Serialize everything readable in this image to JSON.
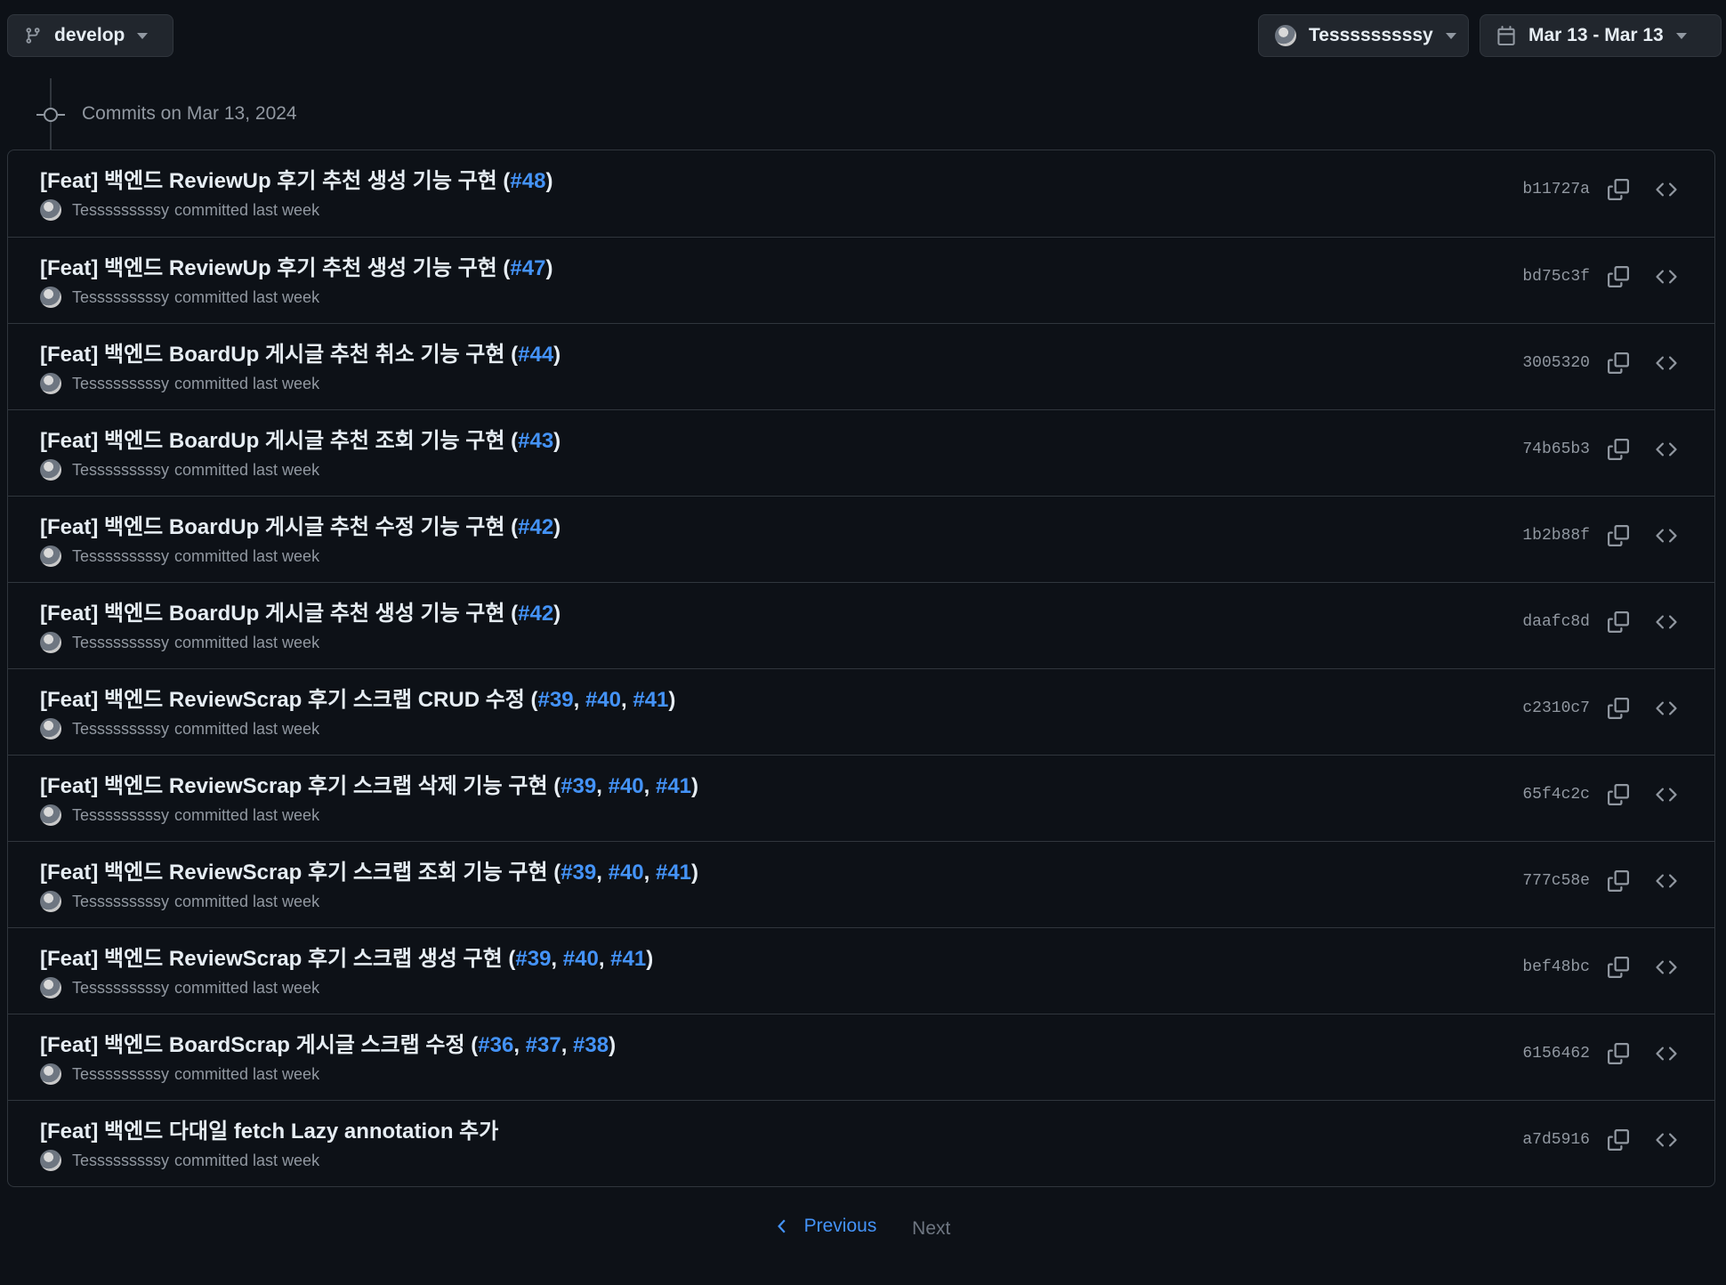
{
  "toolbar": {
    "branch": "develop",
    "author": "Tesssssssssy",
    "date_range": "Mar 13 - Mar 13"
  },
  "timeline": {
    "heading": "Commits on Mar 13, 2024"
  },
  "commits": [
    {
      "prefix": "[Feat] 백엔드 ReviewUp 후기 추천 생성 기능 구현 (",
      "refs": [
        "#48"
      ],
      "suffix": ")",
      "author": "Tesssssssssy",
      "meta": "committed last week",
      "sha": "b11727a"
    },
    {
      "prefix": "[Feat] 백엔드 ReviewUp 후기 추천 생성 기능 구현 (",
      "refs": [
        "#47"
      ],
      "suffix": ")",
      "author": "Tesssssssssy",
      "meta": "committed last week",
      "sha": "bd75c3f"
    },
    {
      "prefix": "[Feat] 백엔드 BoardUp 게시글 추천 취소 기능 구현 (",
      "refs": [
        "#44"
      ],
      "suffix": ")",
      "author": "Tesssssssssy",
      "meta": "committed last week",
      "sha": "3005320"
    },
    {
      "prefix": "[Feat] 백엔드 BoardUp 게시글 추천 조회 기능 구현 (",
      "refs": [
        "#43"
      ],
      "suffix": ")",
      "author": "Tesssssssssy",
      "meta": "committed last week",
      "sha": "74b65b3"
    },
    {
      "prefix": "[Feat] 백엔드 BoardUp 게시글 추천 수정 기능 구현 (",
      "refs": [
        "#42"
      ],
      "suffix": ")",
      "author": "Tesssssssssy",
      "meta": "committed last week",
      "sha": "1b2b88f"
    },
    {
      "prefix": "[Feat] 백엔드 BoardUp 게시글 추천 생성 기능 구현 (",
      "refs": [
        "#42"
      ],
      "suffix": ")",
      "author": "Tesssssssssy",
      "meta": "committed last week",
      "sha": "daafc8d"
    },
    {
      "prefix": "[Feat] 백엔드 ReviewScrap 후기 스크랩 CRUD 수정 (",
      "refs": [
        "#39",
        "#40",
        "#41"
      ],
      "suffix": ")",
      "author": "Tesssssssssy",
      "meta": "committed last week",
      "sha": "c2310c7"
    },
    {
      "prefix": "[Feat] 백엔드 ReviewScrap 후기 스크랩 삭제 기능 구현 (",
      "refs": [
        "#39",
        "#40",
        "#41"
      ],
      "suffix": ")",
      "author": "Tesssssssssy",
      "meta": "committed last week",
      "sha": "65f4c2c"
    },
    {
      "prefix": "[Feat] 백엔드 ReviewScrap 후기 스크랩 조회 기능 구현 (",
      "refs": [
        "#39",
        "#40",
        "#41"
      ],
      "suffix": ")",
      "author": "Tesssssssssy",
      "meta": "committed last week",
      "sha": "777c58e"
    },
    {
      "prefix": "[Feat] 백엔드 ReviewScrap 후기 스크랩 생성 구현 (",
      "refs": [
        "#39",
        "#40",
        "#41"
      ],
      "suffix": ")",
      "author": "Tesssssssssy",
      "meta": "committed last week",
      "sha": "bef48bc"
    },
    {
      "prefix": "[Feat] 백엔드 BoardScrap 게시글 스크랩 수정 (",
      "refs": [
        "#36",
        "#37",
        "#38"
      ],
      "suffix": ")",
      "author": "Tesssssssssy",
      "meta": "committed last week",
      "sha": "6156462"
    },
    {
      "prefix": "[Feat] 백엔드 다대일 fetch Lazy annotation 추가",
      "refs": [],
      "suffix": "",
      "author": "Tesssssssssy",
      "meta": "committed last week",
      "sha": "a7d5916"
    }
  ],
  "pagination": {
    "previous": "Previous",
    "next": "Next"
  },
  "icons": {
    "branch": "git-branch-icon",
    "calendar": "calendar-icon",
    "commit": "git-commit-icon",
    "copy": "copy-icon",
    "code": "code-icon",
    "chevron_left": "chevron-left-icon"
  },
  "colors": {
    "background": "#0d1117",
    "link": "#4493f8",
    "muted": "#9198a1",
    "border": "#30363d"
  }
}
